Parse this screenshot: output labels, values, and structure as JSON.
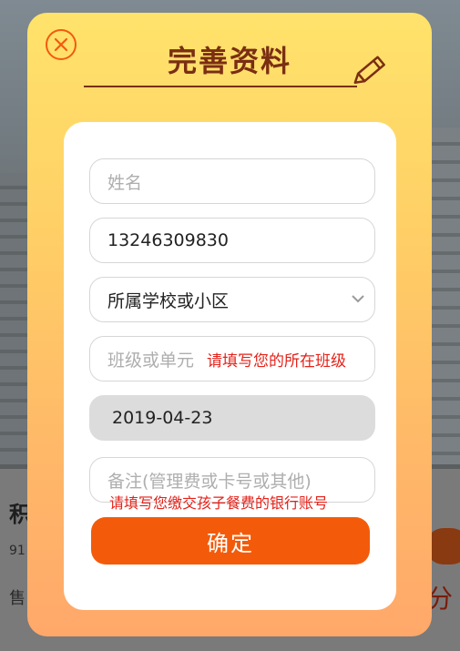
{
  "background": {
    "title": "积",
    "subtitle": "91",
    "sale_label": "售",
    "points_suffix": "分"
  },
  "dialog": {
    "title": "完善资料",
    "fields": {
      "name": {
        "placeholder": "姓名",
        "value": ""
      },
      "phone": {
        "value": "13246309830"
      },
      "school": {
        "value": "所属学校或小区"
      },
      "class": {
        "placeholder": "班级或单元",
        "hint": "请填写您的所在班级"
      },
      "date": {
        "value": "2019-04-23"
      },
      "note": {
        "placeholder": "备注(管理费或卡号或其他)",
        "hint": "请填写您缴交孩子餐费的银行账号"
      }
    },
    "confirm_label": "确定"
  },
  "colors": {
    "accent": "#f35b0a",
    "hint": "#e4221a",
    "title": "#7a2e12"
  },
  "icons": {
    "close": "close-icon",
    "pencil": "pencil-icon",
    "dropdown": "chevron-down-icon"
  }
}
